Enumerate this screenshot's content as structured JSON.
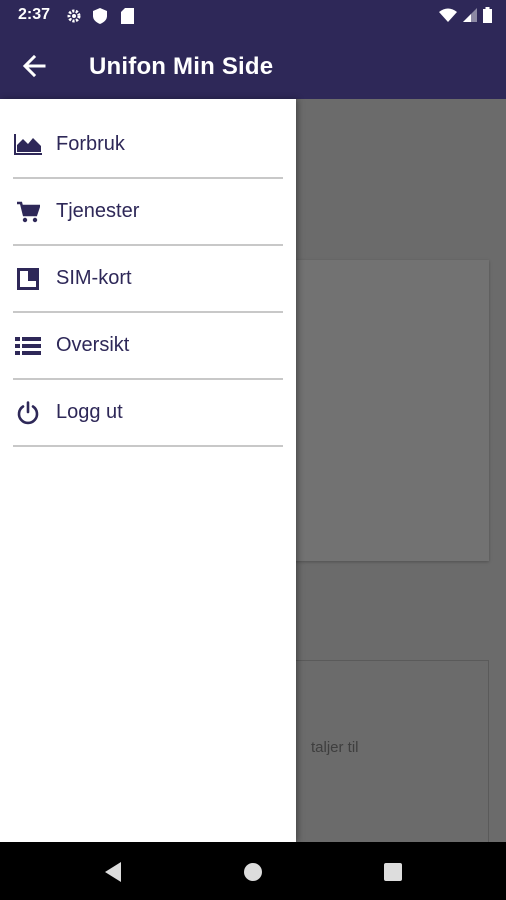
{
  "status_bar": {
    "time": "2:37",
    "icons": [
      "settings-icon",
      "shield-icon",
      "sim-card-icon",
      "wifi-icon",
      "signal-icon",
      "battery-icon"
    ]
  },
  "app_bar": {
    "title": "Unifon Min Side",
    "back_icon": "arrow-back-icon"
  },
  "drawer": {
    "items": [
      {
        "label": "Forbruk",
        "icon": "area-chart-icon"
      },
      {
        "label": "Tjenester",
        "icon": "cart-icon"
      },
      {
        "label": "SIM-kort",
        "icon": "sim-panel-icon"
      },
      {
        "label": "Oversikt",
        "icon": "list-icon"
      },
      {
        "label": "Logg ut",
        "icon": "power-icon"
      }
    ]
  },
  "background": {
    "partial_text": "taljer til"
  },
  "nav_bar": {
    "buttons": [
      "back-triangle-icon",
      "home-circle-icon",
      "recents-square-icon"
    ]
  },
  "colors": {
    "primary": "#2e2858",
    "scrim": "#6b6b6b",
    "divider": "#c8c8c8"
  }
}
